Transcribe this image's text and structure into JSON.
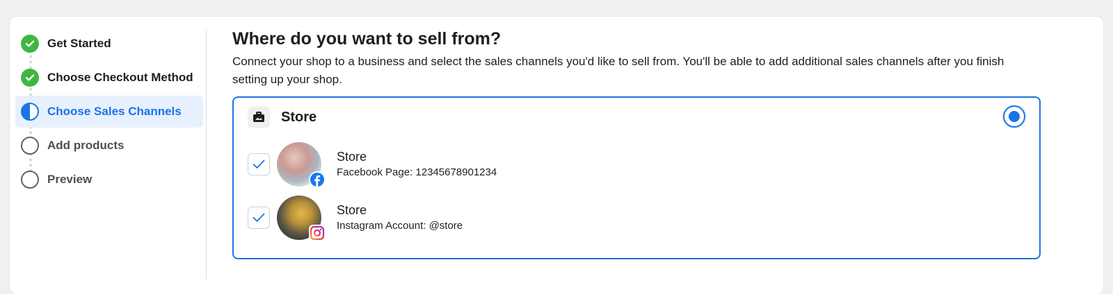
{
  "steps": [
    {
      "label": "Get Started",
      "state": "done"
    },
    {
      "label": "Choose Checkout Method",
      "state": "done"
    },
    {
      "label": "Choose Sales Channels",
      "state": "active"
    },
    {
      "label": "Add products",
      "state": "todo"
    },
    {
      "label": "Preview",
      "state": "todo"
    }
  ],
  "main": {
    "title": "Where do you want to sell from?",
    "description": "Connect your shop to a business and select the sales channels you'd like to sell from. You'll be able to add additional sales channels after you finish setting up your shop."
  },
  "channel_group": {
    "icon": "store-icon",
    "title": "Store",
    "selected": true,
    "accounts": [
      {
        "name": "Store",
        "subtitle": "Facebook Page: 12345678901234",
        "platform_icon": "facebook-icon",
        "checked": true
      },
      {
        "name": "Store",
        "subtitle": "Instagram Account: @store",
        "platform_icon": "instagram-icon",
        "checked": true
      }
    ]
  },
  "colors": {
    "accent": "#1b74e4",
    "success": "#3fb643",
    "active_bg": "#e7f0fd"
  }
}
